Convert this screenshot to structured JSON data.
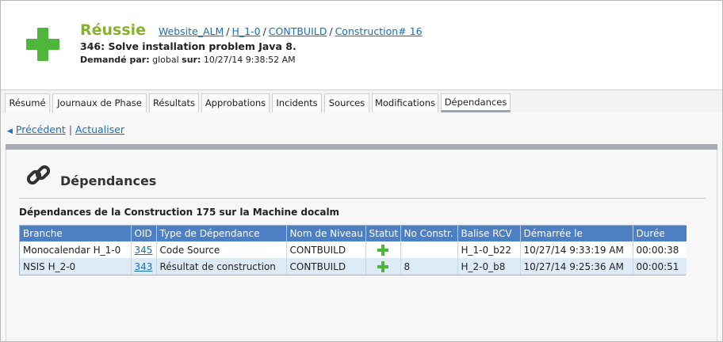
{
  "header": {
    "status": "Réussie",
    "breadcrumb": [
      "Website_ALM",
      "H_1-0",
      "CONTBUILD",
      "Construction# 16"
    ],
    "build_title": "346: Solve installation problem Java 8.",
    "requested_by_label": "Demandé par:",
    "requested_by_value": "global",
    "on_label": "sur:",
    "on_value": "10/27/14 9:38:52 AM",
    "status_color": "#87b22a",
    "icon": "plus-icon"
  },
  "tabs": [
    {
      "label": "Résumé"
    },
    {
      "label": "Journaux de Phase"
    },
    {
      "label": "Résultats"
    },
    {
      "label": "Approbations"
    },
    {
      "label": "Incidents"
    },
    {
      "label": "Sources"
    },
    {
      "label": "Modifications"
    },
    {
      "label": "Dépendances",
      "active": true
    }
  ],
  "actions": {
    "previous": "Précédent",
    "separator": "|",
    "refresh": "Actualiser"
  },
  "section": {
    "title": "Dépendances",
    "icon": "chain-link-icon",
    "subtitle": "Dépendances de la Construction 175 sur la Machine docalm"
  },
  "table": {
    "columns": [
      "Branche",
      "OID",
      "Type de Dépendance",
      "Nom de Niveau",
      "Statut",
      "No Constr.",
      "Balise RCV",
      "Démarrée le",
      "Durée"
    ],
    "rows": [
      {
        "branch": "Monocalendar H_1-0",
        "oid": "345",
        "type": "Code Source",
        "level": "CONTBUILD",
        "status": "plus-icon",
        "build_no": "",
        "rcv_tag": "H_1-0_b22",
        "started": "10/27/14 9:33:19 AM",
        "duration": "00:00:38"
      },
      {
        "branch": "NSIS H_2-0",
        "oid": "343",
        "type": "Résultat de construction",
        "level": "CONTBUILD",
        "status": "plus-icon",
        "build_no": "8",
        "rcv_tag": "H_2-0_b8",
        "started": "10/27/14 9:25:36 AM",
        "duration": "00:00:51"
      }
    ],
    "header_color": "#4d7fc4",
    "alt_row_color": "#dfeaf7"
  }
}
